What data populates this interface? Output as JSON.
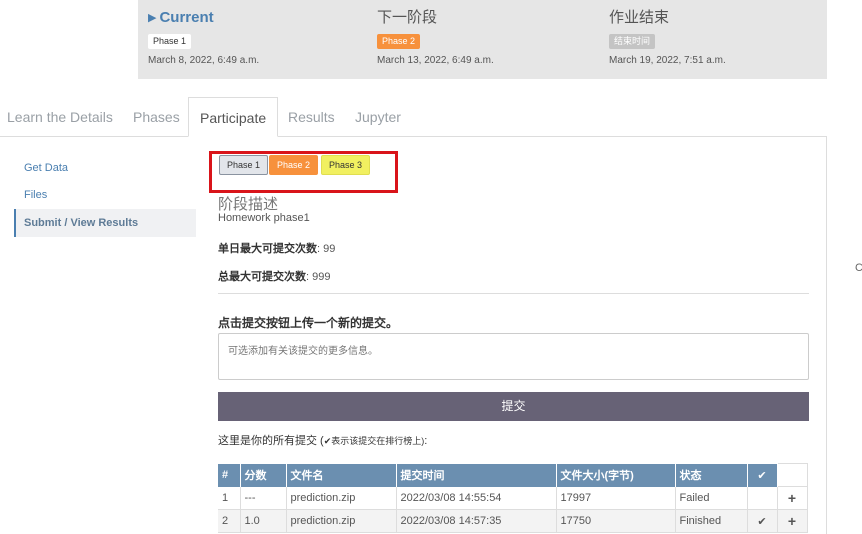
{
  "phases": [
    {
      "title": "Current",
      "badge": "Phase 1",
      "date": "March 8, 2022, 6:49 a.m."
    },
    {
      "title": "下一阶段",
      "badge": "Phase 2",
      "date": "March 13, 2022, 6:49 a.m."
    },
    {
      "title": "作业结束",
      "badge": "结束时间",
      "date": "March 19, 2022, 7:51 a.m."
    }
  ],
  "tabs": [
    "Learn the Details",
    "Phases",
    "Participate",
    "Results",
    "Jupyter"
  ],
  "sidebar": [
    "Get Data",
    "Files",
    "Submit / View Results"
  ],
  "phase_buttons": [
    "Phase 1",
    "Phase 2",
    "Phase 3"
  ],
  "description": {
    "title": "阶段描述",
    "text": "Homework phase1"
  },
  "limits": {
    "daily_label": "单日最大可提交次数",
    "daily_value": ": 99",
    "total_label": "总最大可提交次数",
    "total_value": ": 999"
  },
  "upload": {
    "label": "点击提交按钮上传一个新的提交。",
    "placeholder": "可选添加有关该提交的更多信息。",
    "submit_label": "提交"
  },
  "submissions_label": "这里是你的所有提交 (",
  "submissions_note": "✔表示该提交在排行榜上)",
  "submissions_colon": ":",
  "table": {
    "headers": [
      "#",
      "分数",
      "文件名",
      "提交时间",
      "文件大小(字节)",
      "状态",
      "✔",
      ""
    ],
    "rows": [
      {
        "num": "1",
        "score": "---",
        "file": "prediction.zip",
        "time": "2022/03/08 14:55:54",
        "size": "17997",
        "status": "Failed",
        "check": "",
        "action": "+"
      },
      {
        "num": "2",
        "score": "1.0",
        "file": "prediction.zip",
        "time": "2022/03/08 14:57:35",
        "size": "17750",
        "status": "Finished",
        "check": "✔",
        "action": "+"
      }
    ]
  },
  "edge_glyph": "C"
}
